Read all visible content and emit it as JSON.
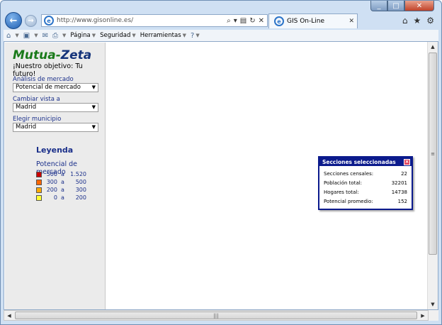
{
  "browser": {
    "url": "http://www.gisonline.es/",
    "tab_title": "GIS On-Line",
    "caption_buttons": {
      "minimize": "_",
      "maximize": "□",
      "close": "✕"
    },
    "right_icons": [
      "home-icon",
      "favorites-star-icon",
      "tools-gear-icon"
    ]
  },
  "commandbar": {
    "items": [
      {
        "label": "Página"
      },
      {
        "label": "Seguridad"
      },
      {
        "label": "Herramientas"
      }
    ]
  },
  "sidebar": {
    "logo": {
      "part1": "Mutua",
      "dash": "-",
      "part2": "Zeta"
    },
    "slogan": "¡Nuestro objetivo: Tu futuro!",
    "fields": [
      {
        "label": "Análisis de mercado",
        "value": "Potencial de mercado"
      },
      {
        "label": "Cambiar vista a",
        "value": "Madrid"
      },
      {
        "label": "Elegir municipio",
        "value": "Madrid"
      }
    ],
    "legend": {
      "title": "Leyenda",
      "subtitle": "Potencial de mercado",
      "items": [
        {
          "from": "500",
          "sep": "a",
          "to": "1.520",
          "color": "#cc0000"
        },
        {
          "from": "300",
          "sep": "a",
          "to": "500",
          "color": "#ff6600"
        },
        {
          "from": "200",
          "sep": "a",
          "to": "300",
          "color": "#ffaa00"
        },
        {
          "from": "0",
          "sep": "a",
          "to": "200",
          "color": "#ffff33"
        }
      ]
    }
  },
  "popup": {
    "title": "Secciones seleccionadas",
    "rows": [
      {
        "label": "Secciones censales:",
        "value": "22"
      },
      {
        "label": "Población total:",
        "value": "32201"
      },
      {
        "label": "Hogares total:",
        "value": "14738"
      },
      {
        "label": "Potencial promedio:",
        "value": "152"
      }
    ]
  },
  "colors": {
    "popup_border": "#0b1a8c",
    "label_blue": "#1a2f8a",
    "logo_green": "#1a7a1a",
    "logo_navy": "#14337a"
  }
}
